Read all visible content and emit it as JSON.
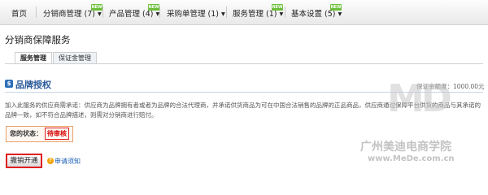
{
  "nav": {
    "items": [
      {
        "label": "首页",
        "has_new": false
      },
      {
        "label": "分销商管理 (7) ▾",
        "has_new": true
      },
      {
        "label": "产品管理 (4) ▾",
        "has_new": true
      },
      {
        "label": "采购单管理 (1) ▾",
        "has_new": false
      },
      {
        "label": "服务管理 (1) ▾",
        "has_new": true
      },
      {
        "label": "基本设置 (5) ▾",
        "has_new": true
      }
    ],
    "badge_text": "NEW"
  },
  "page": {
    "title": "分销商保障服务"
  },
  "tabs": [
    {
      "label": "服务管理",
      "active": true
    },
    {
      "label": "保证金管理",
      "active": false
    }
  ],
  "section": {
    "title": "品牌授权",
    "deposit": "保证金额度：1000.00元",
    "description": "加入此服务的供应商需承诺：供应商为品牌拥有者或者为品牌的合法代理商，并承诺供货商品为可在中国合法销售的品牌的正品商品，供应商通过保障平台供货的商品与其承诺的品牌一致，如不符合品牌描述，则需对分销商进行赔付。"
  },
  "status": {
    "label": "您的状态：",
    "value": "待审核"
  },
  "actions": {
    "cancel_label": "撤销开通",
    "help_label": "申请须知"
  },
  "watermark": {
    "logo": "MD",
    "text": "广州美迪电商学院",
    "url": "www.MeDe.com.cn"
  },
  "colors": {
    "accent": "#2a5a9a",
    "status_red": "#d60000",
    "new_badge": "#6cbf3a"
  }
}
